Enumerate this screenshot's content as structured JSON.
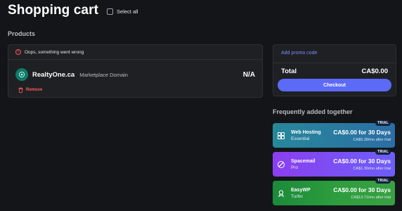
{
  "header": {
    "title": "Shopping cart",
    "select_all_label": "Select all"
  },
  "products": {
    "section_label": "Products",
    "error_text": "Oops, something went wrong",
    "item": {
      "name": "RealtyOne.ca",
      "type": "Marketplace Domain",
      "price": "N/A",
      "remove_label": "Remove"
    }
  },
  "summary": {
    "promo_label": "Add promo code",
    "total_label": "Total",
    "total_value": "CA$0.00",
    "checkout_label": "Checkout"
  },
  "frequently_added": {
    "section_label": "Frequently added together",
    "items": [
      {
        "name": "Web Hosting",
        "sub": "Essential",
        "price": "CA$0.00 for 30 Days",
        "after": "CA$5.38/mo after trial",
        "badge": "TRIAL",
        "icon": "hosting-icon"
      },
      {
        "name": "Spacemail",
        "sub": "Pro",
        "price": "CA$0.00 for 30 Days",
        "after": "CA$1.36/mo after trial",
        "badge": "TRIAL",
        "icon": "mail-icon"
      },
      {
        "name": "EasyWP",
        "sub": "Turbo",
        "price": "CA$0.00 for 30 Days",
        "after": "CA$13.71/mo after trial",
        "badge": "TRIAL",
        "icon": "wordpress-icon"
      }
    ]
  },
  "colors": {
    "background": "#141518",
    "card": "#1f2023",
    "accent": "#5b6af7",
    "error": "#ff5a5a",
    "link": "#7f8cff"
  }
}
